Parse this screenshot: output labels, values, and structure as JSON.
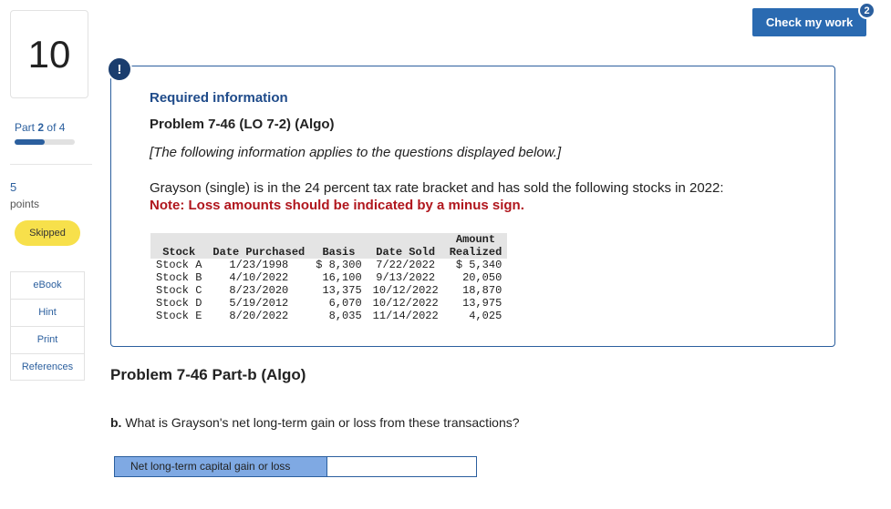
{
  "sidebar": {
    "question_number": "10",
    "part_label": "Part",
    "part_current": "2",
    "part_of": "of 4",
    "progress_fraction": 0.5,
    "points_value": "5",
    "points_label": "points",
    "status_badge": "Skipped",
    "resources": [
      "eBook",
      "Hint",
      "Print",
      "References"
    ]
  },
  "header": {
    "check_button": "Check my work",
    "check_badge": "2"
  },
  "info_panel": {
    "alert_glyph": "!",
    "required_info": "Required information",
    "problem_title": "Problem 7-46 (LO 7-2) (Algo)",
    "applies_note": "[The following information applies to the questions displayed below.]",
    "description": "Grayson (single) is in the 24 percent tax rate bracket and has sold the following stocks in 2022:",
    "loss_note": "Note: Loss amounts should be indicated by a minus sign."
  },
  "stock_table": {
    "headers": [
      "Stock",
      "Date Purchased",
      "Basis",
      "Date Sold",
      "Amount\nRealized"
    ],
    "rows": [
      [
        "Stock A",
        "1/23/1998",
        "$ 8,300",
        "7/22/2022",
        "$ 5,340"
      ],
      [
        "Stock B",
        "4/10/2022",
        "16,100",
        "9/13/2022",
        "20,050"
      ],
      [
        "Stock C",
        "8/23/2020",
        "13,375",
        "10/12/2022",
        "18,870"
      ],
      [
        "Stock D",
        "5/19/2012",
        "6,070",
        "10/12/2022",
        "13,975"
      ],
      [
        "Stock E",
        "8/20/2022",
        "8,035",
        "11/14/2022",
        "4,025"
      ]
    ]
  },
  "part_b": {
    "title": "Problem 7-46 Part-b (Algo)",
    "question_prefix": "b.",
    "question_text": "What is Grayson's net long-term gain or loss from these transactions?",
    "answer_label": "Net long-term capital gain or loss",
    "answer_value": ""
  },
  "colors": {
    "accent": "#2b5f9e",
    "button": "#2a6ab1",
    "note_red": "#b0161d",
    "skipped_yellow": "#f7e04b",
    "answer_label_bg": "#7fa9e3"
  }
}
